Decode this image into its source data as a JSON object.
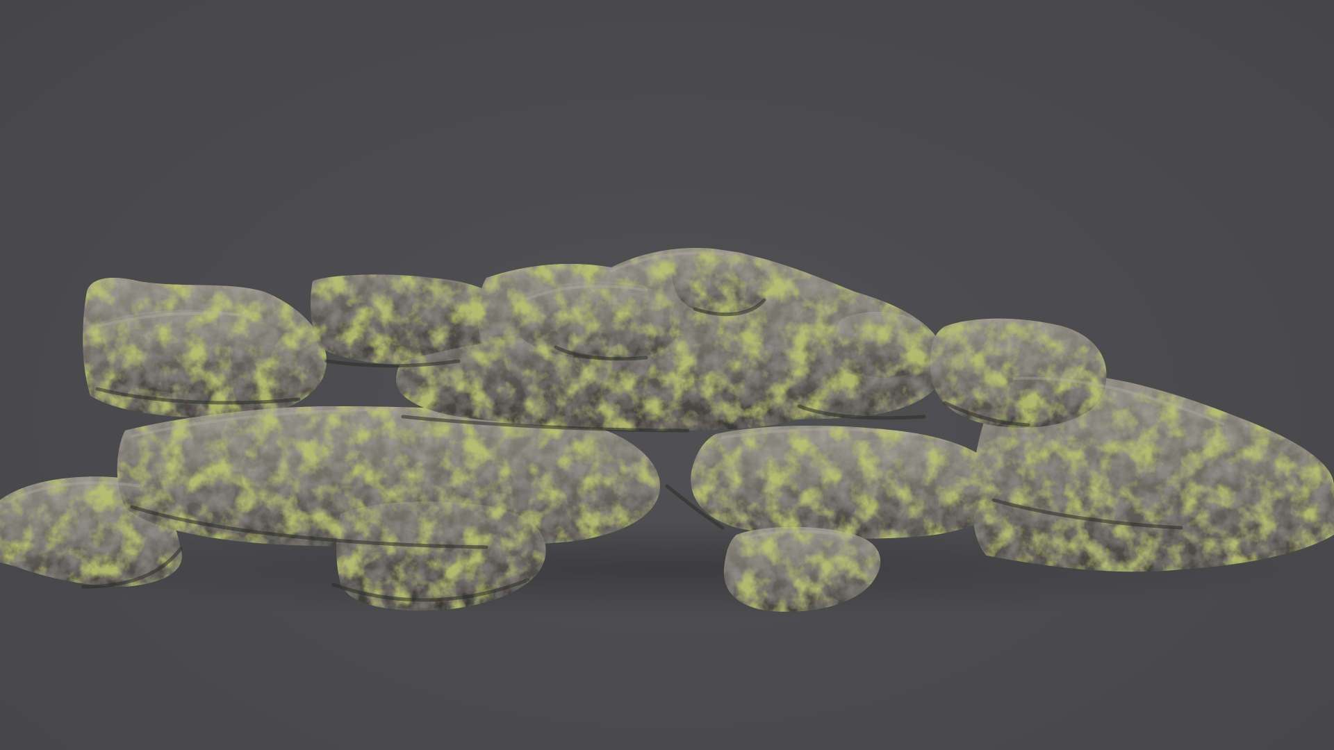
{
  "scene": {
    "subject_icon": "mossy-rock-formation-icon",
    "colors": {
      "background": "#4b4b4d",
      "rock_light": "#8d8a80",
      "rock_mid": "#6b6a62",
      "rock_dark": "#3f3e39",
      "moss_bright": "#8a9a2c",
      "moss_mid": "#6c7a24",
      "moss_dark": "#4a5520"
    }
  }
}
